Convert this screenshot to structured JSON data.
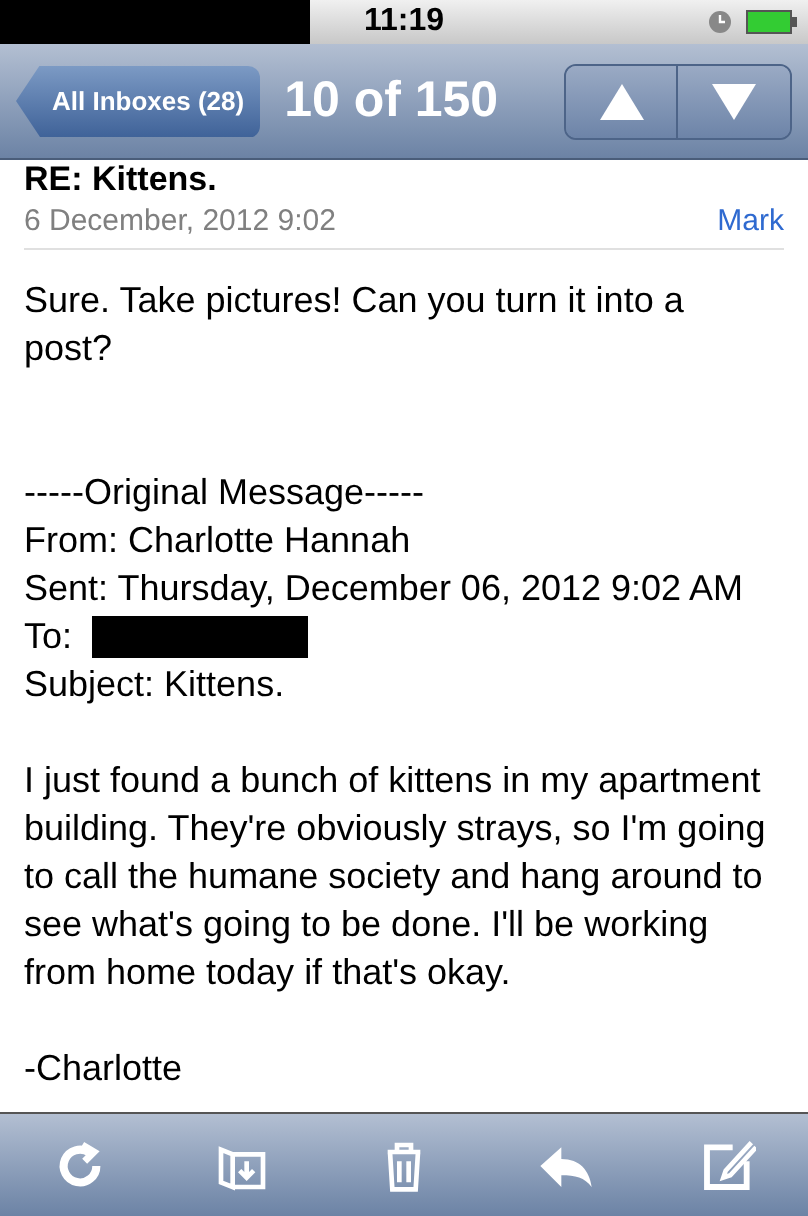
{
  "status_bar": {
    "time": "11:19"
  },
  "nav_bar": {
    "back": "All Inboxes (28)",
    "title": "10 of 150"
  },
  "message": {
    "subject": "RE: Kittens.",
    "date": "6 December, 2012 9:02",
    "mark": "Mark",
    "reply": "Sure. Take pictures! Can you turn it into a post?",
    "original_header": "-----Original Message-----",
    "from": "From: Charlotte Hannah",
    "sent": "Sent: Thursday, December 06, 2012 9:02 AM",
    "to": "To:",
    "subject_line": "Subject: Kittens.",
    "paragraph": "I just found a bunch of kittens in my apartment building. They're obviously strays, so I'm going to call the humane society and hang around to see what's going to be done. I'll be working from home today if that's okay.",
    "signature": "-Charlotte"
  }
}
